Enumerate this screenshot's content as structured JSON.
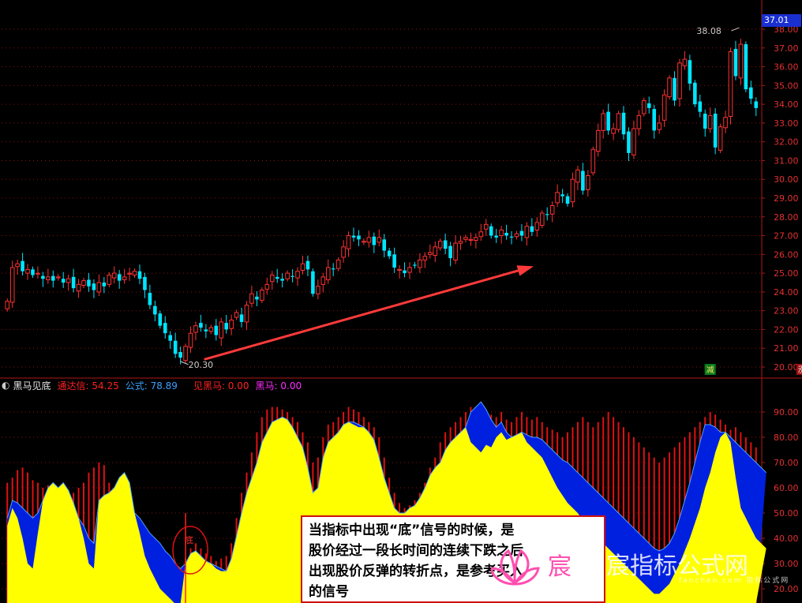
{
  "colors": {
    "up": "#ff3232",
    "down": "#00e5ff",
    "axis": "#b01818",
    "grid": "#8a1010",
    "yellow": "#ffff00",
    "blue": "#0020e0",
    "arrow": "#ff3a3a"
  },
  "top_title": "",
  "indicator": {
    "name": "黑马见底",
    "params": [
      {
        "label": "通达信: 54.25",
        "color": "#ff2020"
      },
      {
        "label": "公式: 78.89",
        "color": "#3aa0ff"
      },
      {
        "label": "见黑马: 0.00",
        "color": "#ff2020"
      },
      {
        "label": "黑马: 0.00",
        "color": "#ff2bff"
      }
    ]
  },
  "price_panel": {
    "last_price_tag": "37.01",
    "high_label": "38.08",
    "low_label": "20.30",
    "y_ticks": [
      "38.00",
      "37.00",
      "36.00",
      "35.00",
      "34.00",
      "33.00",
      "32.00",
      "31.00",
      "30.00",
      "29.00",
      "28.00",
      "27.00",
      "26.00",
      "25.00",
      "24.00",
      "23.00",
      "22.00",
      "21.00",
      "20.00"
    ],
    "markers": [
      {
        "text": "减"
      },
      {
        "text": "涨"
      }
    ]
  },
  "indicator_panel": {
    "y_ticks": [
      "90.00",
      "80.00",
      "70.00",
      "60.00",
      "50.00",
      "40.00",
      "30.00",
      "20.00"
    ],
    "bottom_marker": "底"
  },
  "annotation": {
    "lines": [
      "当指标中出现“底”信号的时候，是",
      "股价经过一段长时间的连续下跌之后",
      "出现股价反弹的转折点，是参考买入",
      "的信号"
    ]
  },
  "watermark": {
    "text": "宸指标公式网",
    "sub": "fanchen.com 指标公式网"
  },
  "chart_data": [
    {
      "type": "candlestick",
      "title": "",
      "ylim": [
        19.8,
        38.2
      ],
      "closes": [
        23.5,
        25.3,
        25.5,
        25.1,
        25.2,
        24.9,
        25.0,
        24.7,
        24.8,
        24.6,
        24.8,
        24.5,
        24.7,
        24.2,
        24.4,
        24.6,
        24.3,
        24.1,
        24.5,
        24.3,
        24.9,
        25.0,
        24.6,
        24.8,
        25.0,
        25.1,
        24.7,
        24.1,
        23.3,
        22.8,
        22.2,
        21.8,
        21.4,
        20.7,
        20.5,
        21.1,
        21.8,
        22.2,
        22.1,
        21.9,
        22.1,
        21.7,
        22.4,
        22.0,
        22.5,
        22.9,
        22.4,
        23.3,
        23.9,
        23.6,
        24.1,
        24.4,
        24.9,
        24.7,
        24.6,
        25.0,
        24.8,
        25.1,
        25.5,
        25.2,
        23.9,
        24.3,
        24.8,
        25.3,
        25.2,
        25.7,
        26.4,
        27.0,
        26.9,
        26.8,
        26.7,
        26.9,
        26.5,
        26.9,
        26.2,
        25.9,
        25.3,
        25.2,
        25.0,
        25.3,
        25.4,
        25.7,
        25.9,
        26.1,
        26.4,
        26.7,
        26.3,
        25.8,
        26.6,
        26.7,
        26.9,
        26.8,
        26.9,
        27.2,
        27.6,
        27.0,
        26.9,
        27.3,
        27.0,
        26.9,
        27.1,
        27.0,
        27.5,
        27.2,
        27.7,
        28.2,
        28.1,
        28.6,
        29.3,
        29.1,
        28.7,
        30.0,
        30.5,
        29.4,
        30.2,
        31.6,
        32.6,
        33.5,
        32.6,
        32.7,
        33.5,
        32.4,
        31.4,
        32.7,
        33.4,
        34.2,
        33.8,
        32.6,
        33.0,
        34.5,
        35.4,
        34.2,
        36.2,
        36.4,
        35.1,
        34.0,
        33.6,
        32.7,
        33.4,
        31.7,
        32.8,
        33.3,
        36.8,
        35.5,
        37.2,
        34.8,
        34.3,
        33.8
      ],
      "xlabel": "",
      "ylabel": ""
    },
    {
      "type": "area",
      "title": "",
      "ylim": [
        15,
        98
      ],
      "series": [
        {
          "name": "",
          "values": [
            45,
            52,
            48,
            40,
            30,
            28,
            42,
            55,
            60,
            62,
            60,
            62,
            59,
            54,
            48,
            40,
            30,
            28,
            55,
            57,
            58,
            60,
            64,
            66,
            62,
            50,
            42,
            33,
            28,
            24,
            20,
            18,
            16,
            14,
            14,
            30,
            34,
            35,
            33,
            31,
            30,
            28,
            27,
            27,
            32,
            41,
            50,
            58,
            64,
            70,
            78,
            82,
            86,
            87,
            88,
            87,
            84,
            80,
            76,
            68,
            58,
            60,
            72,
            78,
            80,
            82,
            85,
            86,
            85,
            84,
            84,
            82,
            79,
            72,
            64,
            58,
            52,
            50,
            50,
            52,
            53,
            56,
            60,
            65,
            68,
            70,
            75,
            78,
            80,
            82,
            84,
            78,
            76,
            74,
            77,
            76,
            80,
            82,
            79,
            80,
            81,
            82,
            78,
            76,
            74,
            72,
            68,
            64,
            60,
            57,
            54,
            52,
            50,
            47,
            45,
            42,
            40,
            38,
            36,
            34,
            32,
            30,
            28,
            26,
            24,
            22,
            20,
            18,
            18,
            20,
            22,
            26,
            30,
            35,
            40,
            46,
            52,
            60,
            66,
            74,
            80,
            82,
            78,
            64,
            52,
            48,
            44,
            40,
            38,
            36
          ]
        },
        {
          "name": "",
          "values": [
            48,
            55,
            54,
            52,
            50,
            48,
            50,
            55,
            60,
            62,
            60,
            62,
            59,
            54,
            48,
            45,
            40,
            38,
            55,
            57,
            58,
            60,
            64,
            66,
            62,
            50,
            48,
            45,
            42,
            40,
            38,
            35,
            33,
            30,
            28,
            30,
            34,
            35,
            33,
            31,
            30,
            29,
            28,
            27,
            32,
            41,
            50,
            58,
            64,
            70,
            78,
            82,
            86,
            87,
            88,
            87,
            84,
            80,
            76,
            68,
            58,
            60,
            72,
            78,
            80,
            82,
            85,
            86,
            86,
            85,
            84,
            82,
            79,
            72,
            64,
            58,
            52,
            50,
            50,
            52,
            53,
            56,
            60,
            65,
            68,
            70,
            75,
            78,
            80,
            82,
            84,
            90,
            92,
            94,
            91,
            87,
            84,
            86,
            82,
            80,
            81,
            82,
            81,
            80,
            80,
            79,
            77,
            75,
            73,
            71,
            70,
            68,
            66,
            64,
            62,
            60,
            58,
            56,
            54,
            52,
            50,
            48,
            46,
            44,
            42,
            40,
            38,
            36,
            35,
            36,
            38,
            42,
            48,
            55,
            62,
            70,
            78,
            85,
            85,
            84,
            82,
            82,
            80,
            78,
            76,
            74,
            72,
            70,
            68,
            66
          ]
        },
        {
          "name": "",
          "values": [
            62,
            64,
            67,
            68,
            66,
            63,
            62,
            60,
            61,
            62,
            58,
            60,
            59,
            58,
            60,
            62,
            66,
            68,
            70,
            69,
            62,
            60,
            58,
            56,
            52,
            48,
            44,
            40,
            36,
            32,
            28,
            26,
            24,
            22,
            20,
            32,
            36,
            38,
            36,
            34,
            33,
            31,
            32,
            33,
            38,
            48,
            58,
            66,
            74,
            82,
            88,
            91,
            92,
            92,
            91,
            90,
            88,
            86,
            82,
            78,
            70,
            72,
            80,
            85,
            86,
            88,
            90,
            92,
            91,
            90,
            88,
            86,
            84,
            80,
            72,
            64,
            58,
            54,
            52,
            53,
            55,
            58,
            62,
            68,
            72,
            78,
            82,
            84,
            86,
            88,
            90,
            92,
            92,
            94,
            91,
            89,
            88,
            90,
            87,
            86,
            88,
            90,
            88,
            87,
            88,
            86,
            84,
            83,
            82,
            80,
            82,
            84,
            86,
            88,
            86,
            84,
            86,
            88,
            90,
            88,
            86,
            84,
            82,
            80,
            78,
            76,
            74,
            72,
            70,
            72,
            74,
            76,
            78,
            80,
            82,
            84,
            86,
            88,
            90,
            89,
            87,
            85,
            83,
            84,
            82,
            80,
            78,
            76,
            74,
            72
          ]
        }
      ],
      "xlabel": "",
      "ylabel": ""
    }
  ]
}
